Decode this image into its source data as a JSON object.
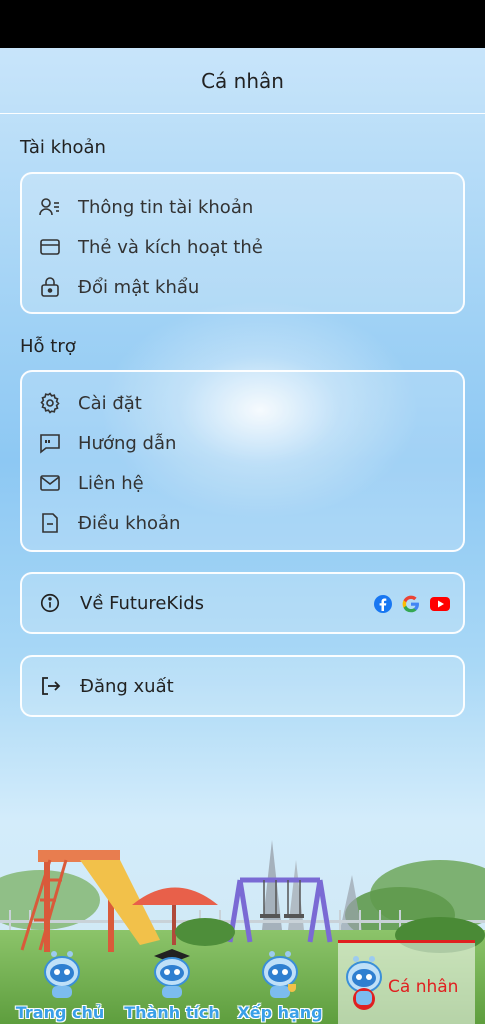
{
  "header": {
    "title": "Cá nhân"
  },
  "account": {
    "title": "Tài khoản",
    "items": [
      {
        "label": "Thông tin tài khoản",
        "icon": "user-info-icon"
      },
      {
        "label": "Thẻ và kích hoạt thẻ",
        "icon": "card-icon"
      },
      {
        "label": "Đổi mật khẩu",
        "icon": "lock-icon"
      }
    ]
  },
  "support": {
    "title": "Hỗ trợ",
    "items": [
      {
        "label": "Cài đặt",
        "icon": "gear-icon"
      },
      {
        "label": "Hướng dẫn",
        "icon": "quote-chat-icon"
      },
      {
        "label": "Liên hệ",
        "icon": "mail-icon"
      },
      {
        "label": "Điều khoản",
        "icon": "document-icon"
      }
    ]
  },
  "about": {
    "label": "Về FutureKids",
    "icon": "info-icon",
    "social": [
      "facebook-icon",
      "google-icon",
      "youtube-icon"
    ]
  },
  "logout": {
    "label": "Đăng xuất",
    "icon": "logout-icon"
  },
  "bottom_nav": {
    "items": [
      {
        "label": "Trang chủ",
        "icon": "robot-home-icon"
      },
      {
        "label": "Thành tích",
        "icon": "robot-graduate-icon"
      },
      {
        "label": "Xếp hạng",
        "icon": "robot-trophy-icon"
      },
      {
        "label": "Cá nhân",
        "icon": "robot-profile-icon",
        "active": true
      }
    ]
  },
  "colors": {
    "accent": "#3aa0e8",
    "active": "#e02020",
    "text": "#333333"
  }
}
